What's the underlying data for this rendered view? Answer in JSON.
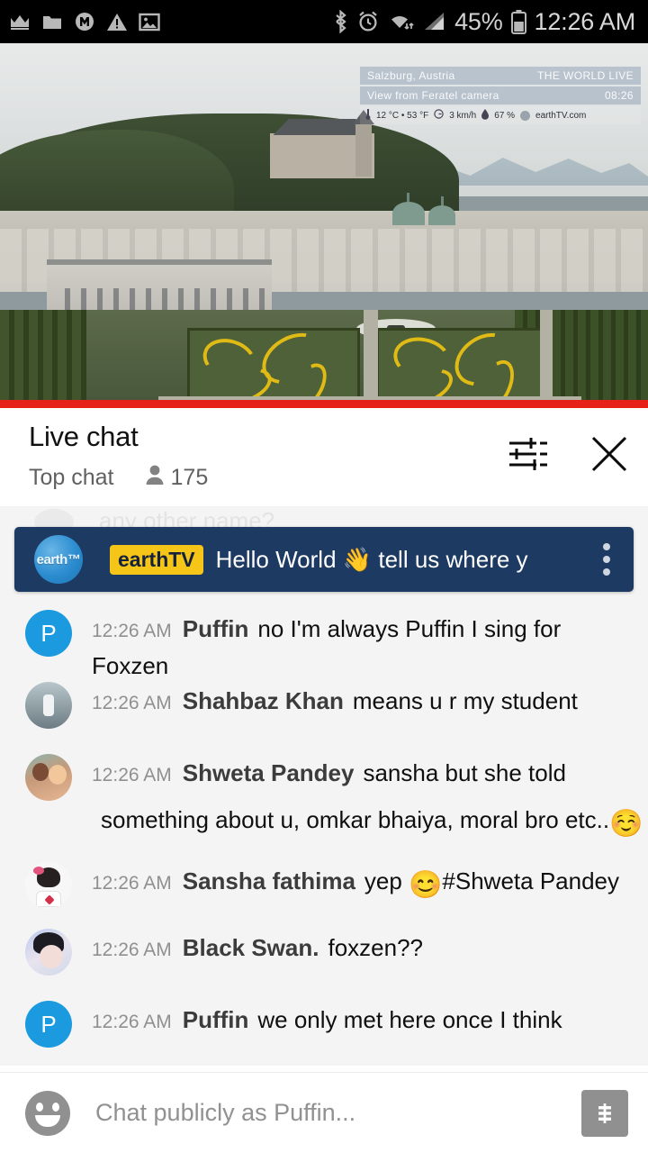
{
  "status_bar": {
    "left_icons": [
      "crown-icon",
      "folder-icon",
      "m-circle-icon",
      "warning-triangle-icon",
      "image-icon"
    ],
    "right_icons": [
      "bluetooth-icon",
      "alarm-icon",
      "wifi-icon",
      "signal-icon",
      "battery-icon"
    ],
    "battery_percent": "45%",
    "time": "12:26 AM"
  },
  "video": {
    "location": "Salzburg, Austria",
    "brand_line": "THE WORLD LIVE",
    "camera_line": "View from Feratel camera",
    "clock": "08:26",
    "temperature": "12 °C • 53 °F",
    "wind": "3 km/h",
    "humidity": "67 %",
    "site": "earthTV.com"
  },
  "chat_header": {
    "title": "Live chat",
    "mode": "Top chat",
    "viewer_count": "175",
    "settings_icon": "tune-icon",
    "close_icon": "close-icon"
  },
  "ghost_text": "any other name?",
  "pinned_message": {
    "avatar_label": "earth™",
    "badge": "earthTV",
    "text": "Hello World 👋 tell us where y",
    "menu_icon": "overflow-menu-icon"
  },
  "messages": [
    {
      "time": "12:26 AM",
      "author": "Puffin",
      "text": "no I'm always Puffin I sing for Foxzen",
      "avatar_type": "initial",
      "initial": "P"
    },
    {
      "time": "12:26 AM",
      "author": "Shahbaz Khan",
      "text": "means u r my student",
      "avatar_type": "photo-shahbaz"
    },
    {
      "time": "12:26 AM",
      "author": "Shweta Pandey",
      "text": "sansha but she told",
      "text_line2": "something about u, omkar bhaiya, moral bro etc..",
      "emoji": "☺️",
      "avatar_type": "photo-shweta"
    },
    {
      "time": "12:26 AM",
      "author": "Sansha fathima",
      "text": "yep",
      "emoji": "😊",
      "text_after_emoji": "#Shweta Pandey",
      "avatar_type": "photo-sansha"
    },
    {
      "time": "12:26 AM",
      "author": "Black Swan.",
      "text": "foxzen??",
      "avatar_type": "photo-swan"
    },
    {
      "time": "12:26 AM",
      "author": "Puffin",
      "text": "we only met here once I think",
      "avatar_type": "initial",
      "initial": "P"
    }
  ],
  "input_bar": {
    "emoji_icon": "emoji-smiley-icon",
    "placeholder": "Chat publicly as Puffin...",
    "superchat_label": "$",
    "superchat_icon": "super-chat-icon"
  },
  "colors": {
    "progress_red": "#e62117",
    "pinned_navy": "#1d3a63",
    "badge_yellow": "#f5c518",
    "avatar_blue": "#1c9ae0",
    "chat_bg": "#f4f4f4"
  }
}
